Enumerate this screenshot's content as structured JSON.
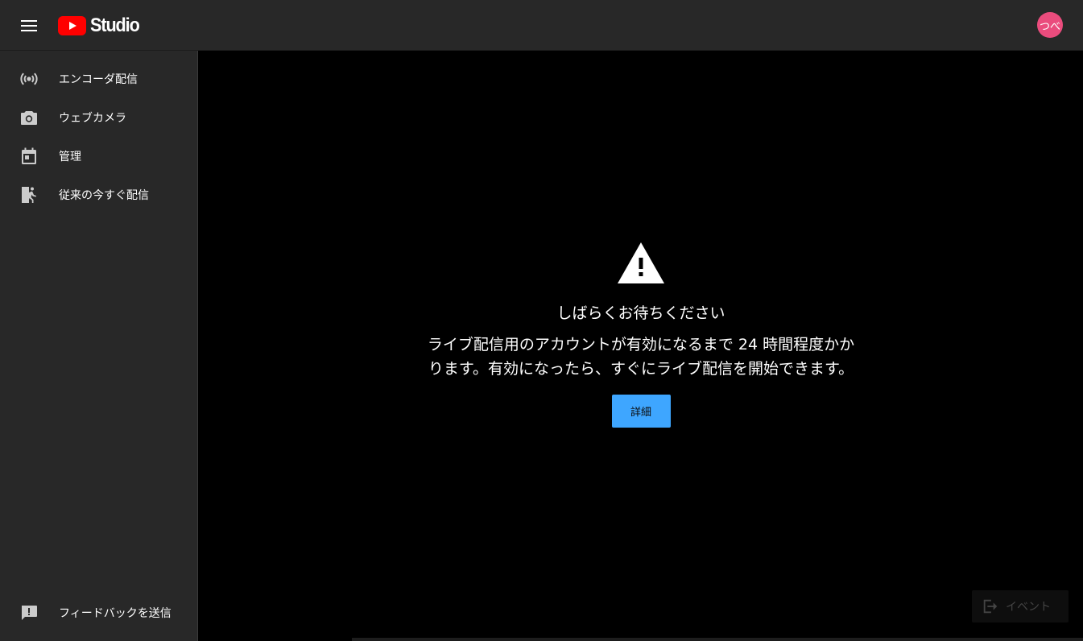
{
  "app": {
    "wordmark": "Studio",
    "avatar_initials": "つべ",
    "colors": {
      "topbar": "#282828",
      "sidebar": "#282828",
      "main_bg": "#000000",
      "youtube_red": "#ff0000",
      "accent_blue": "#3ea6ff",
      "avatar_bg": "#ea4c7d"
    }
  },
  "sidebar": {
    "items": [
      {
        "label": "エンコーダ配信",
        "icon": "broadcast-icon"
      },
      {
        "label": "ウェブカメラ",
        "icon": "camera-icon"
      },
      {
        "label": "管理",
        "icon": "calendar-icon"
      },
      {
        "label": "従来の今すぐ配信",
        "icon": "classic-stream-icon"
      }
    ],
    "feedback": {
      "label": "フィードバックを送信",
      "icon": "feedback-icon"
    }
  },
  "main": {
    "notice": {
      "icon": "warning-icon",
      "title": "しばらくお待ちください",
      "body": "ライブ配信用のアカウントが有効になるまで 24 時間程度かかります。有効になったら、すぐにライブ配信を開始できます。",
      "button_label": "詳細"
    },
    "event_button": {
      "label": "イベント",
      "icon": "exit-icon"
    }
  }
}
